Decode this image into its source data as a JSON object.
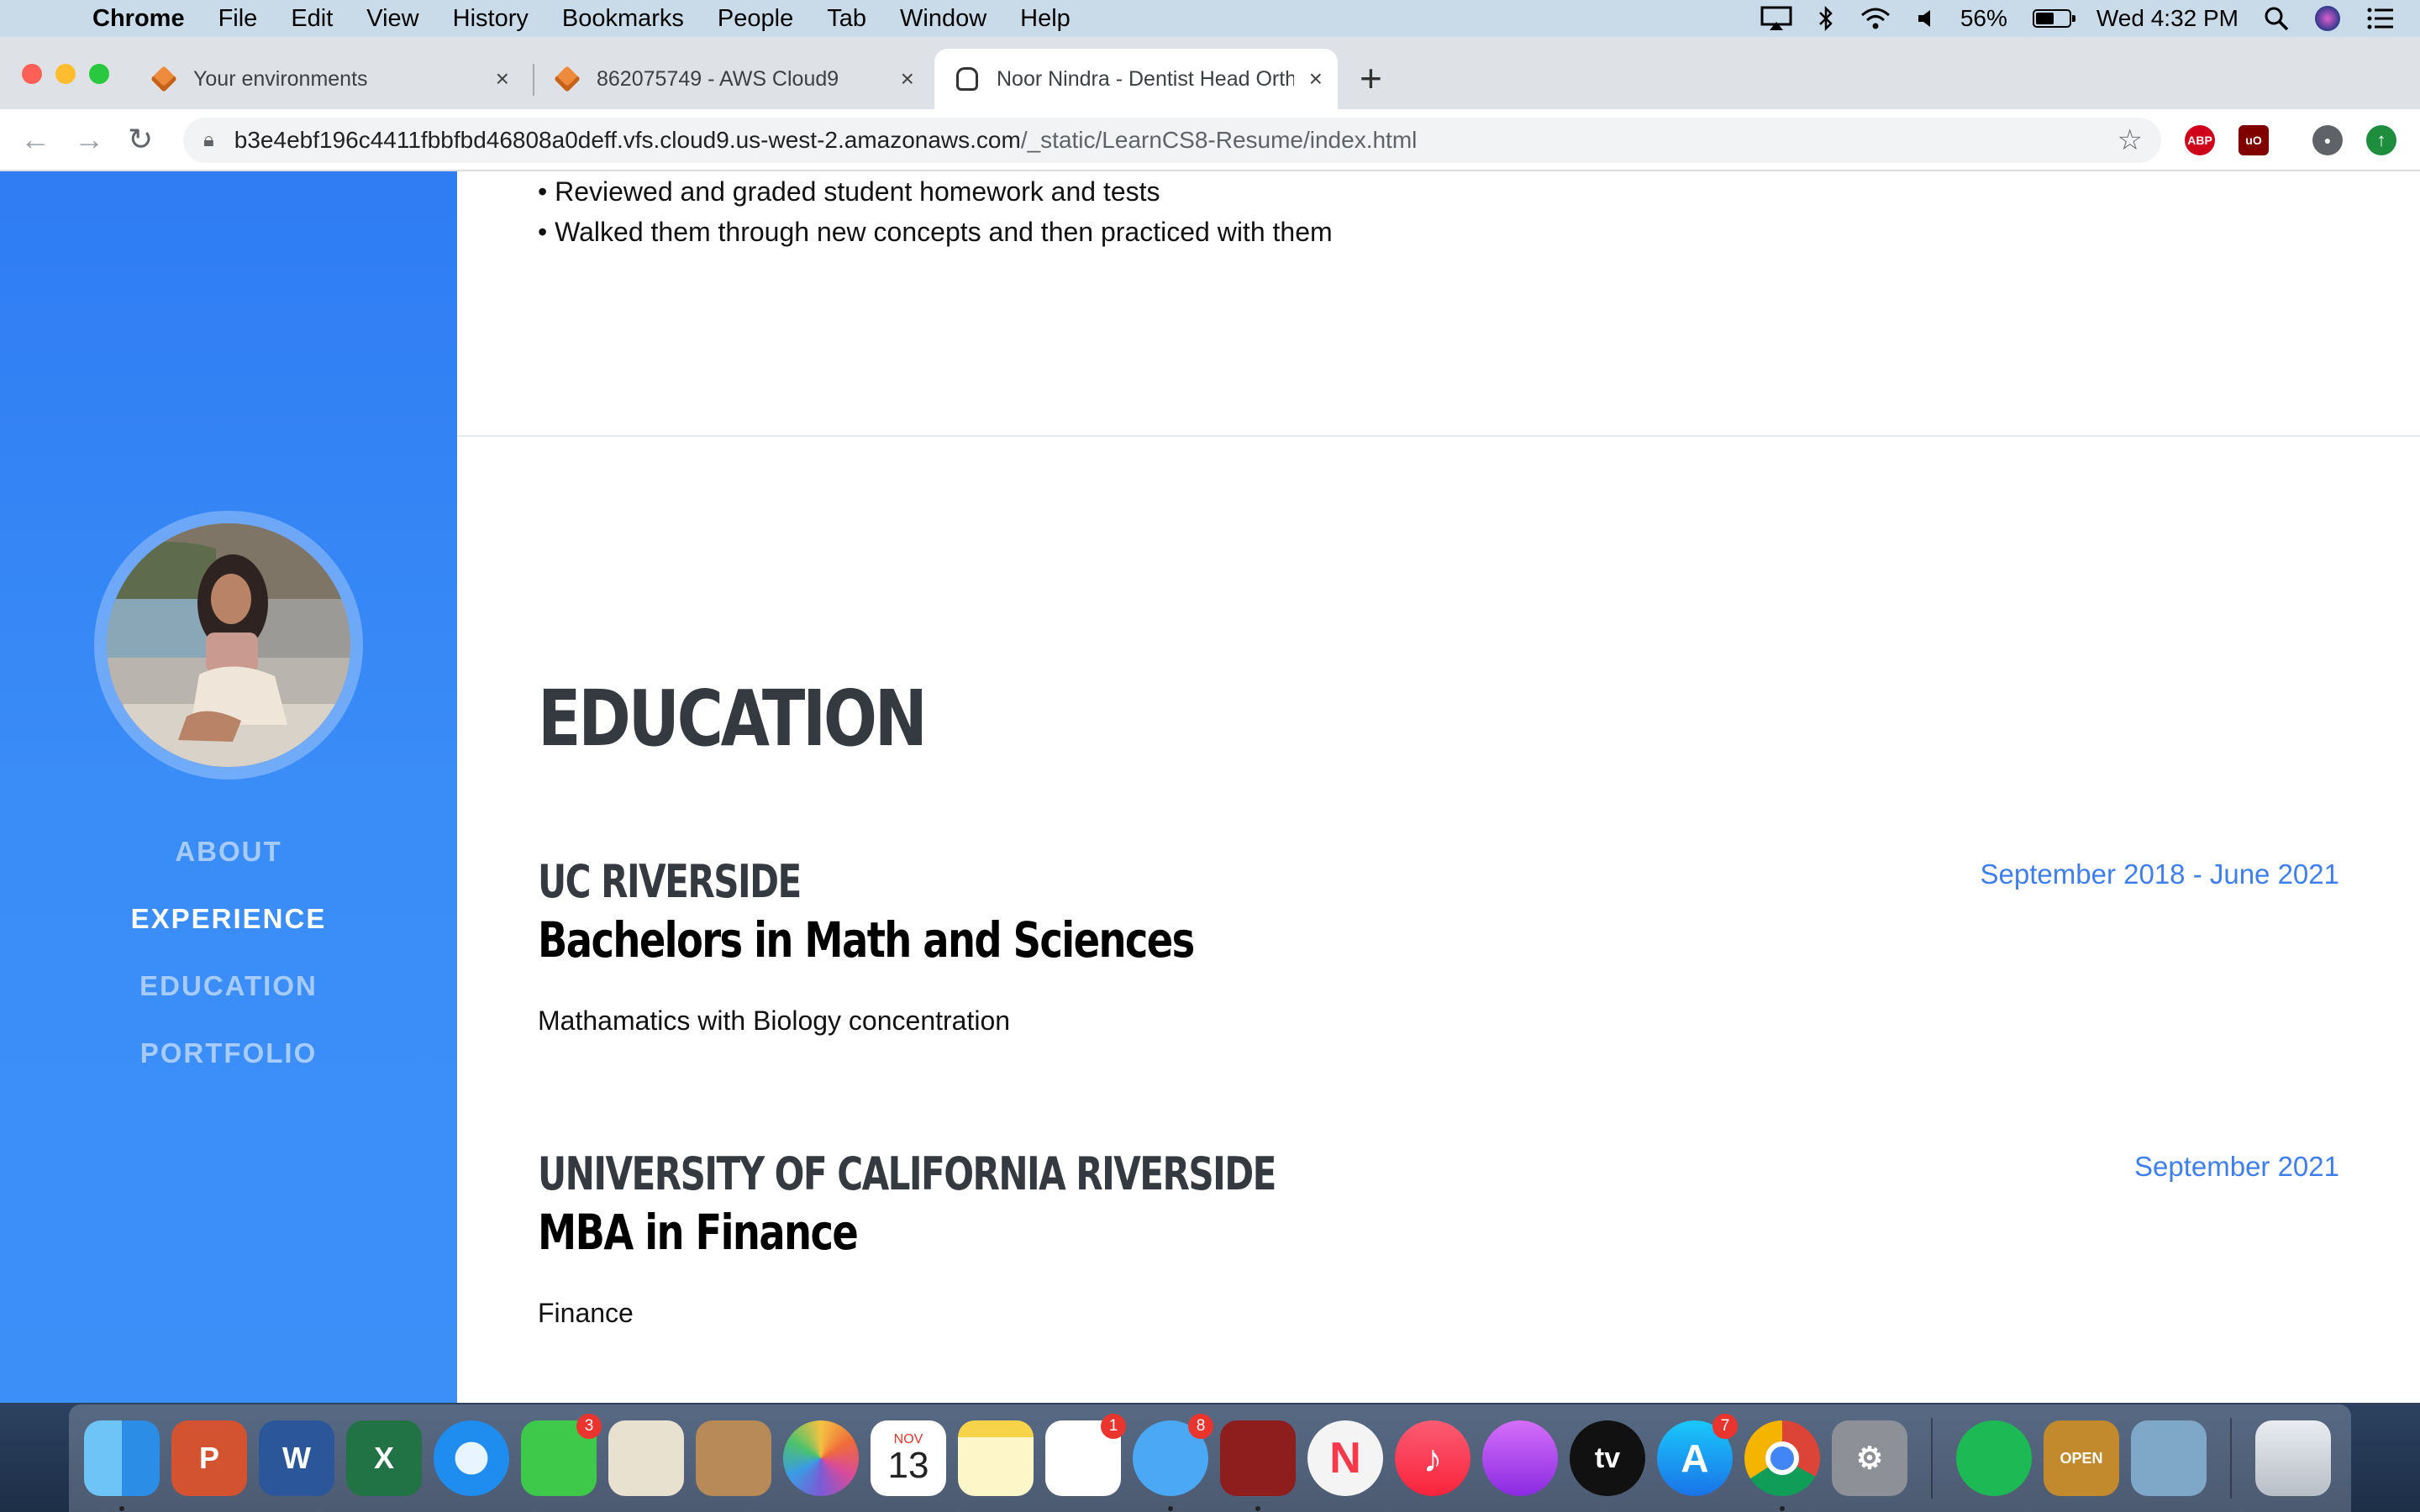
{
  "menubar": {
    "app": "Chrome",
    "items": [
      "File",
      "Edit",
      "View",
      "History",
      "Bookmarks",
      "People",
      "Tab",
      "Window",
      "Help"
    ],
    "battery_percent": "56%",
    "battery_level": 0.56,
    "clock": "Wed 4:32 PM"
  },
  "tabs": [
    {
      "title": "Your environments",
      "icon": "aws-cloud9-cube-icon"
    },
    {
      "title": "862075749 - AWS Cloud9",
      "icon": "aws-cloud9-cube-icon"
    },
    {
      "title": "Noor Nindra - Dentist Head Orth",
      "icon": "tooth-icon",
      "active": true
    }
  ],
  "address_bar": {
    "host": "b3e4ebf196c4411fbbfbd46808a0deff.vfs.cloud9.us-west-2.amazonaws.com",
    "path": "/_static/LearnCS8-Resume/index.html"
  },
  "extensions": [
    "ABP",
    "uO"
  ],
  "sidebar": {
    "nav": [
      {
        "label": "About",
        "active": false
      },
      {
        "label": "Experience",
        "active": true
      },
      {
        "label": "Education",
        "active": false
      },
      {
        "label": "Portfolio",
        "active": false
      }
    ]
  },
  "experience_bullets": [
    "• Reviewed and graded student homework and tests",
    "• Walked them through new concepts and then practiced with them"
  ],
  "education": {
    "heading": "Education",
    "items": [
      {
        "school": "UC Riverside",
        "degree": "Bachelors in Math and Sciences",
        "detail": "Mathamatics with Biology concentration",
        "date": "September 2018 - June 2021"
      },
      {
        "school": "University of California Riverside",
        "degree": "MBA in Finance",
        "detail": "Finance",
        "date": "September 2021"
      }
    ]
  },
  "dock": {
    "apps": [
      {
        "name": "finder"
      },
      {
        "name": "powerpoint",
        "label": "P"
      },
      {
        "name": "word",
        "label": "W"
      },
      {
        "name": "excel",
        "label": "X"
      },
      {
        "name": "safari"
      },
      {
        "name": "facetime",
        "badge": "3"
      },
      {
        "name": "mail"
      },
      {
        "name": "contacts"
      },
      {
        "name": "photos"
      },
      {
        "name": "calendar",
        "month": "NOV",
        "day": "13"
      },
      {
        "name": "notes"
      },
      {
        "name": "reminders",
        "badge": "1"
      },
      {
        "name": "messages",
        "badge": "8"
      },
      {
        "name": "photo-booth"
      },
      {
        "name": "news"
      },
      {
        "name": "music"
      },
      {
        "name": "podcasts"
      },
      {
        "name": "apple-tv",
        "label": "tv"
      },
      {
        "name": "app-store",
        "badge": "7"
      },
      {
        "name": "chrome"
      },
      {
        "name": "system-preferences"
      },
      {
        "name": "spotify"
      },
      {
        "name": "open-sign",
        "label": "OPEN"
      },
      {
        "name": "preview"
      },
      {
        "name": "trash"
      }
    ]
  }
}
